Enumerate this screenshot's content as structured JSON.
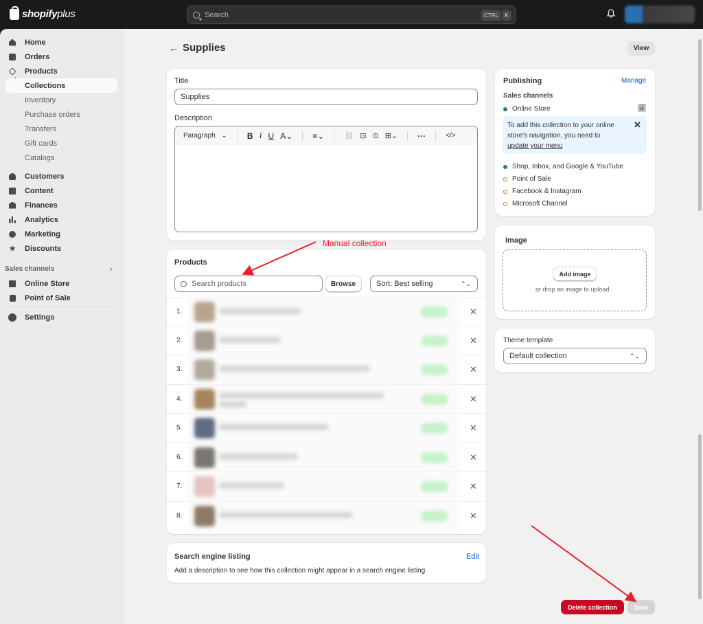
{
  "topbar": {
    "logo_brand": "shopify",
    "logo_plus": "plus",
    "search_placeholder": "Search",
    "shortcut_ctrl": "CTRL",
    "shortcut_k": "K"
  },
  "sidebar": {
    "items": [
      {
        "label": "Home",
        "icon": "home-icon"
      },
      {
        "label": "Orders",
        "icon": "orders-icon"
      },
      {
        "label": "Products",
        "icon": "tag-icon"
      },
      {
        "label": "Collections"
      },
      {
        "label": "Inventory"
      },
      {
        "label": "Purchase orders"
      },
      {
        "label": "Transfers"
      },
      {
        "label": "Gift cards"
      },
      {
        "label": "Catalogs"
      },
      {
        "label": "Customers",
        "icon": "person-icon"
      },
      {
        "label": "Content",
        "icon": "content-icon"
      },
      {
        "label": "Finances",
        "icon": "bank-icon"
      },
      {
        "label": "Analytics",
        "icon": "bar-chart-icon"
      },
      {
        "label": "Marketing",
        "icon": "target-icon"
      },
      {
        "label": "Discounts",
        "icon": "discount-icon"
      }
    ],
    "sales_channels_label": "Sales channels",
    "channels": [
      {
        "label": "Online Store",
        "icon": "store-icon"
      },
      {
        "label": "Point of Sale",
        "icon": "pos-icon"
      }
    ],
    "settings_label": "Settings"
  },
  "page": {
    "title": "Supplies",
    "view_button": "View"
  },
  "details": {
    "title_label": "Title",
    "title_value": "Supplies",
    "description_label": "Description",
    "paragraph_select": "Paragraph"
  },
  "products": {
    "heading": "Products",
    "search_placeholder": "Search products",
    "browse_button": "Browse",
    "sort_select": "Sort: Best selling",
    "rows": [
      {
        "num": "1."
      },
      {
        "num": "2."
      },
      {
        "num": "3."
      },
      {
        "num": "4."
      },
      {
        "num": "5."
      },
      {
        "num": "6."
      },
      {
        "num": "7."
      },
      {
        "num": "8."
      }
    ]
  },
  "seo": {
    "heading": "Search engine listing",
    "edit_link": "Edit",
    "description": "Add a description to see how this collection might appear in a search engine listing"
  },
  "publishing": {
    "heading": "Publishing",
    "manage_link": "Manage",
    "sales_channels_label": "Sales channels",
    "online_store": "Online Store",
    "banner_text": "To add this collection to your online store's navigation, you need to",
    "banner_link": "update your menu",
    "channels": [
      {
        "label": "Shop, Inbox, and Google & YouTube",
        "status": "on"
      },
      {
        "label": "Point of Sale",
        "status": "off"
      },
      {
        "label": "Facebook & Instagram",
        "status": "off"
      },
      {
        "label": "Microsoft Channel",
        "status": "off"
      }
    ]
  },
  "image": {
    "heading": "Image",
    "add_button": "Add image",
    "drop_text": "or drop an image to upload"
  },
  "theme": {
    "label": "Theme template",
    "value": "Default collection"
  },
  "footer": {
    "delete_button": "Delete collection",
    "save_button": "Save"
  },
  "annotations": {
    "manual_collection": "Manual collection"
  },
  "colors": {
    "accent_link": "#005bd3",
    "danger": "#c70a24",
    "annotation_red": "#e8202a",
    "published_green": "#29845a",
    "unpublished_amber": "#b98900"
  }
}
